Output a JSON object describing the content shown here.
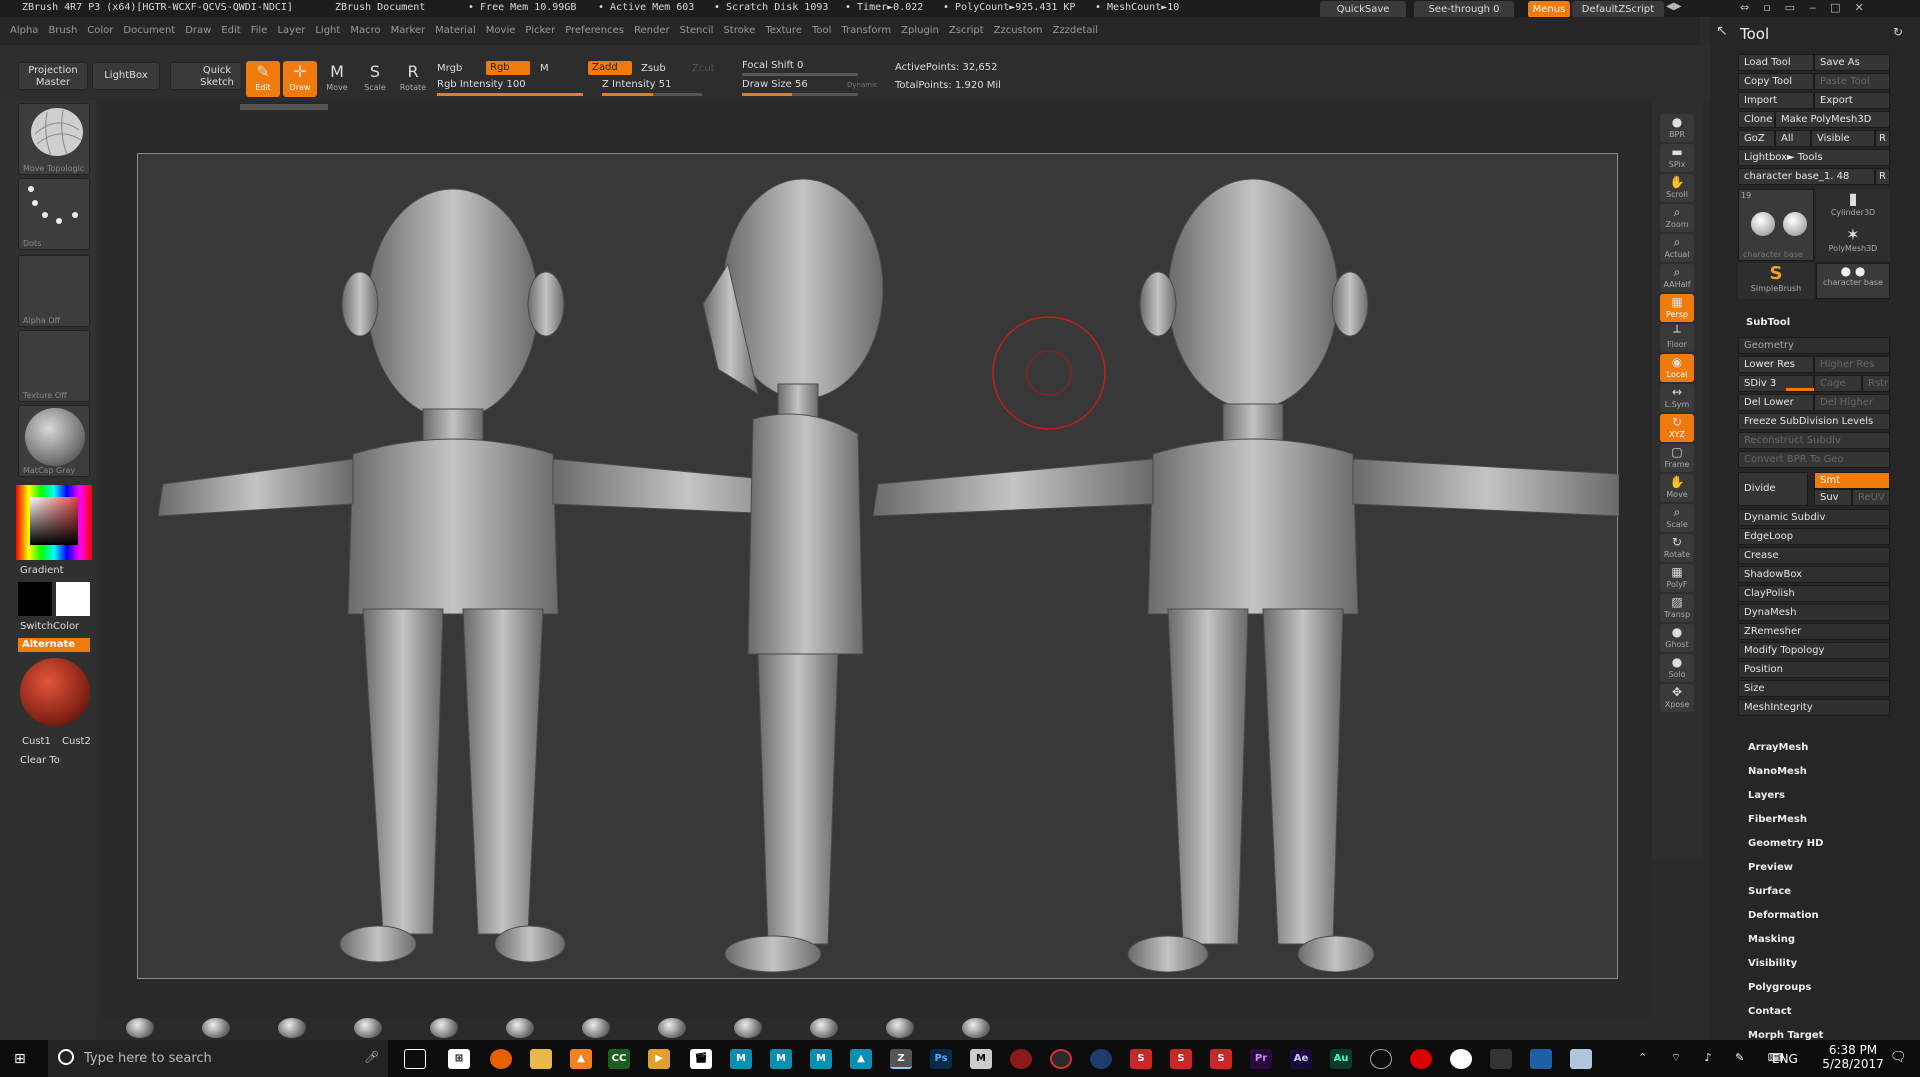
{
  "titlebar": {
    "app": "ZBrush 4R7 P3 (x64)[HGTR-WCXF-QCVS-QWDI-NDCI]",
    "doc": "ZBrush Document",
    "free_mem": "• Free Mem 10.99GB",
    "active_mem": "• Active Mem 603",
    "scratch": "• Scratch Disk 1093",
    "timer": "• Timer►0.022",
    "polycount": "• PolyCount►925.431 KP",
    "meshcount": "• MeshCount►10",
    "quicksave": "QuickSave",
    "seethrough": "See-through  0",
    "menus": "Menus",
    "script": "DefaultZScript"
  },
  "menubar": [
    "Alpha",
    "Brush",
    "Color",
    "Document",
    "Draw",
    "Edit",
    "File",
    "Layer",
    "Light",
    "Macro",
    "Marker",
    "Material",
    "Movie",
    "Picker",
    "Preferences",
    "Render",
    "Stencil",
    "Stroke",
    "Texture",
    "Tool",
    "Transform",
    "Zplugin",
    "Zscript",
    "Zzcustom",
    "Zzzdetail"
  ],
  "shelf": {
    "projection_master": "Projection Master",
    "lightbox": "LightBox",
    "quick_sketch": "Quick Sketch",
    "edit": "Edit",
    "draw": "Draw",
    "move": "Move",
    "scale": "Scale",
    "rotate": "Rotate",
    "mrgb": "Mrgb",
    "rgb": "Rgb",
    "m": "M",
    "zadd": "Zadd",
    "zsub": "Zsub",
    "zcut": "Zcut",
    "rgb_intensity": "Rgb Intensity 100",
    "z_intensity": "Z Intensity 51",
    "z_intensity_value": 51,
    "focal_shift": "Focal Shift 0",
    "draw_size": "Draw Size 56",
    "draw_size_value": 56,
    "dynamic": "Dynamic",
    "active_points": "ActivePoints: 32,652",
    "total_points": "TotalPoints: 1.920 Mil"
  },
  "leftpanel": {
    "brush": "Move Topologic",
    "stroke": "Dots",
    "alpha": "Alpha Off",
    "texture": "Texture Off",
    "material": "MatCap Gray",
    "gradient": "Gradient",
    "switchcolor": "SwitchColor",
    "alternate": "Alternate",
    "cust1": "Cust1",
    "cust2": "Cust2",
    "clear_to": "Clear To"
  },
  "rightbar": [
    {
      "label": "BPR",
      "glyph": "●"
    },
    {
      "label": "SPix",
      "glyph": "▬"
    },
    {
      "label": "Scroll",
      "glyph": "✋"
    },
    {
      "label": "Zoom",
      "glyph": "⌕"
    },
    {
      "label": "Actual",
      "glyph": "⌕"
    },
    {
      "label": "AAHalf",
      "glyph": "⌕"
    },
    {
      "label": "Persp",
      "glyph": "▦"
    },
    {
      "label": "Floor",
      "glyph": "┴"
    },
    {
      "label": "Local",
      "glyph": "◉"
    },
    {
      "label": "L.Sym",
      "glyph": "↔"
    },
    {
      "label": "XYZ",
      "glyph": "↻"
    },
    {
      "label": "Frame",
      "glyph": "▢"
    },
    {
      "label": "Move",
      "glyph": "✋"
    },
    {
      "label": "Scale",
      "glyph": "⌕"
    },
    {
      "label": "Rotate",
      "glyph": "↻"
    },
    {
      "label": "PolyF",
      "glyph": "▦"
    },
    {
      "label": "Transp",
      "glyph": "▨"
    },
    {
      "label": "Ghost",
      "glyph": "●"
    },
    {
      "label": "Solo",
      "glyph": "●"
    },
    {
      "label": "Xpose",
      "glyph": "✥"
    }
  ],
  "tool": {
    "title": "Tool",
    "load_tool": "Load Tool",
    "save_as": "Save As",
    "copy_tool": "Copy Tool",
    "paste_tool": "Paste Tool",
    "import": "Import",
    "export": "Export",
    "clone": "Clone",
    "make_polymesh": "Make PolyMesh3D",
    "goz": "GoZ",
    "all": "All",
    "visible": "Visible",
    "r": "R",
    "lightbox_tools": "Lightbox► Tools",
    "current_tool": "character base_1. 48",
    "count": "19",
    "thumbs": [
      "character base",
      "Cylinder3D",
      "PolyMesh3D",
      "SimpleBrush",
      "character base"
    ],
    "subtool": "SubTool",
    "geometry": "Geometry",
    "lower_res": "Lower Res",
    "higher_res": "Higher Res",
    "sdiv": "SDiv 3",
    "cage": "Cage",
    "rstr": "Rstr",
    "del_lower": "Del Lower",
    "del_higher": "Del Higher",
    "freeze": "Freeze SubDivision Levels",
    "reconstruct": "Reconstruct Subdiv",
    "convert_bpr": "Convert BPR To Geo",
    "divide": "Divide",
    "smt": "Smt",
    "suv": "Suv",
    "reuv": "ReUV",
    "geo_items": [
      "Dynamic Subdiv",
      "EdgeLoop",
      "Crease",
      "ShadowBox",
      "ClayPolish",
      "DynaMesh",
      "ZRemesher",
      "Modify Topology",
      "Position",
      "Size",
      "MeshIntegrity"
    ],
    "sections": [
      "ArrayMesh",
      "NanoMesh",
      "Layers",
      "FiberMesh",
      "Geometry HD",
      "Preview",
      "Surface",
      "Deformation",
      "Masking",
      "Visibility",
      "Polygroups",
      "Contact",
      "Morph Target"
    ]
  },
  "taskbar": {
    "search_placeholder": "Type here to search",
    "time": "6:38 PM",
    "date": "5/28/2017",
    "lang": "ENG"
  },
  "colors": {
    "accent": "#f07b0c",
    "panel": "#262626",
    "canvas": "#383838"
  }
}
